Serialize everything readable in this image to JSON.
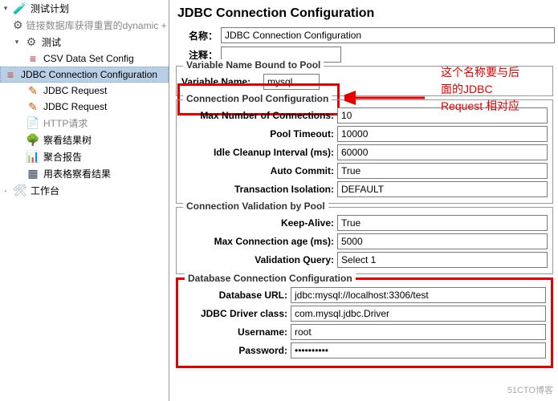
{
  "tree": {
    "root_label": "测试计划",
    "root_tip": "链接数据库获得重置的dynamic + res",
    "test_label": "测试",
    "items": [
      "CSV Data Set Config",
      "JDBC Connection Configuration",
      "JDBC Request",
      "JDBC Request",
      "HTTP请求",
      "察看结果树",
      "聚合报告",
      "用表格察看结果"
    ],
    "workbench": "工作台"
  },
  "main": {
    "title": "JDBC Connection Configuration",
    "name_label": "名称：",
    "name_value": "JDBC Connection Configuration",
    "comment_label": "注释："
  },
  "varpool": {
    "legend": "Variable Name Bound to Pool",
    "var_label": "Variable Name:",
    "var_value": "mysql"
  },
  "connpool": {
    "legend": "Connection Pool Configuration",
    "max_conn_label": "Max Number of Connections:",
    "max_conn_value": "10",
    "pool_timeout_label": "Pool Timeout:",
    "pool_timeout_value": "10000",
    "idle_label": "Idle Cleanup Interval (ms):",
    "idle_value": "60000",
    "auto_commit_label": "Auto Commit:",
    "auto_commit_value": "True",
    "txn_label": "Transaction Isolation:",
    "txn_value": "DEFAULT"
  },
  "validation": {
    "legend": "Connection Validation by Pool",
    "keep_alive_label": "Keep-Alive:",
    "keep_alive_value": "True",
    "max_age_label": "Max Connection age (ms):",
    "max_age_value": "5000",
    "query_label": "Validation Query:",
    "query_value": "Select 1"
  },
  "dbconn": {
    "legend": "Database Connection Configuration",
    "url_label": "Database URL:",
    "url_value": "jdbc:mysql://localhost:3306/test",
    "driver_label": "JDBC Driver class:",
    "driver_value": "com.mysql.jdbc.Driver",
    "user_label": "Username:",
    "user_value": "root",
    "pass_label": "Password:",
    "pass_value": "••••••••••"
  },
  "annotation": {
    "line1": "这个名称要与后",
    "line2": "面的JDBC",
    "line3": "Request 相对应"
  },
  "watermark": "51CTO博客"
}
